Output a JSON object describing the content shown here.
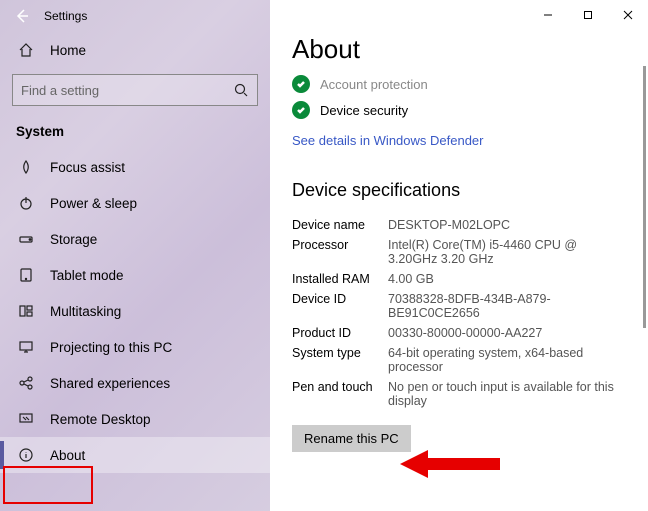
{
  "titlebar": {
    "title": "Settings"
  },
  "sidebar": {
    "home_label": "Home",
    "search_placeholder": "Find a setting",
    "section_header": "System",
    "items": [
      {
        "icon": "focus-assist-icon",
        "label": "Focus assist"
      },
      {
        "icon": "power-icon",
        "label": "Power & sleep"
      },
      {
        "icon": "storage-icon",
        "label": "Storage"
      },
      {
        "icon": "tablet-icon",
        "label": "Tablet mode"
      },
      {
        "icon": "multitasking-icon",
        "label": "Multitasking"
      },
      {
        "icon": "projecting-icon",
        "label": "Projecting to this PC"
      },
      {
        "icon": "shared-icon",
        "label": "Shared experiences"
      },
      {
        "icon": "remote-icon",
        "label": "Remote Desktop"
      },
      {
        "icon": "about-icon",
        "label": "About",
        "selected": true
      }
    ]
  },
  "main": {
    "heading": "About",
    "security": [
      {
        "label": "Account protection",
        "faded": true
      },
      {
        "label": "Device security",
        "faded": false
      }
    ],
    "defender_link": "See details in Windows Defender",
    "specs_heading": "Device specifications",
    "specs": [
      {
        "label": "Device name",
        "value": "DESKTOP-M02LOPC"
      },
      {
        "label": "Processor",
        "value": "Intel(R) Core(TM) i5-4460  CPU @ 3.20GHz 3.20 GHz"
      },
      {
        "label": "Installed RAM",
        "value": "4.00 GB"
      },
      {
        "label": "Device ID",
        "value": "70388328-8DFB-434B-A879-BE91C0CE2656"
      },
      {
        "label": "Product ID",
        "value": "00330-80000-00000-AA227"
      },
      {
        "label": "System type",
        "value": "64-bit operating system, x64-based processor"
      },
      {
        "label": "Pen and touch",
        "value": "No pen or touch input is available for this display"
      }
    ],
    "rename_button": "Rename this PC"
  }
}
